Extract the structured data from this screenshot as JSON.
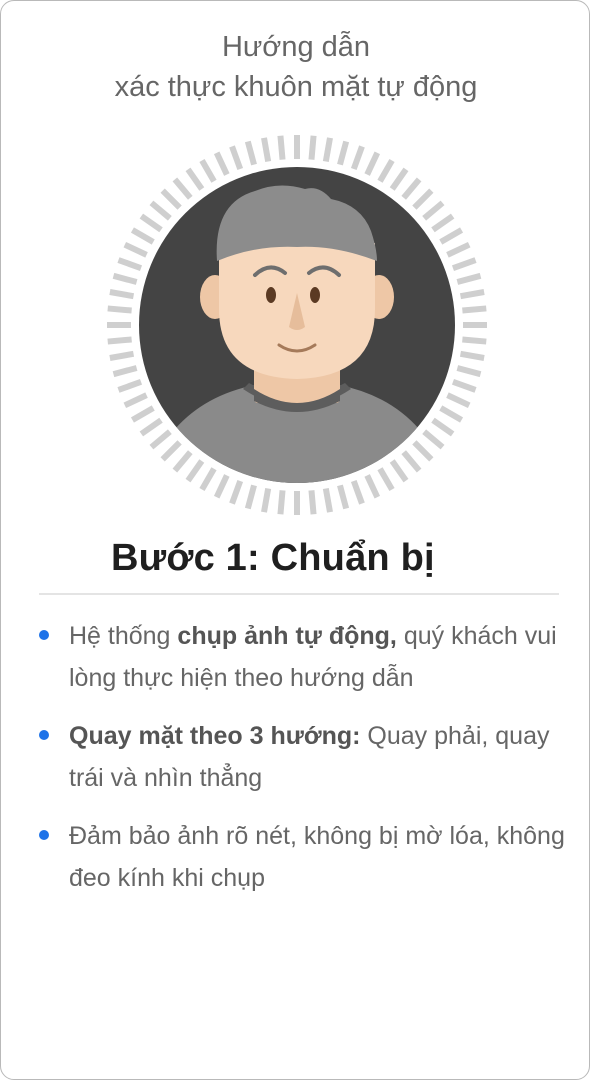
{
  "header": {
    "title_line1": "Hướng dẫn",
    "title_line2": "xác thực khuôn mặt tự động"
  },
  "avatar": {
    "icon": "face-avatar-icon",
    "ring_color": "#cfcfcf",
    "background_color": "#444444",
    "shirt_color": "#8a8a8a",
    "hair_color": "#8c8c8c",
    "skin_color": "#f7d8bd"
  },
  "step": {
    "heading": "Bước 1: Chuẩn bị"
  },
  "instructions": [
    {
      "pre": "Hệ thống ",
      "bold": "chụp ảnh tự động,",
      "post": " quý khách vui lòng thực hiện theo hướng dẫn"
    },
    {
      "pre": "",
      "bold": "Quay mặt theo 3 hướng:",
      "post": " Quay phải, quay trái và nhìn thẳng"
    },
    {
      "pre": "Đảm bảo ảnh rõ nét, không bị mờ lóa, không đeo kính khi chụp",
      "bold": "",
      "post": ""
    }
  ],
  "colors": {
    "accent": "#1e73e8",
    "text": "#666666",
    "heading": "#1f1f1f"
  }
}
